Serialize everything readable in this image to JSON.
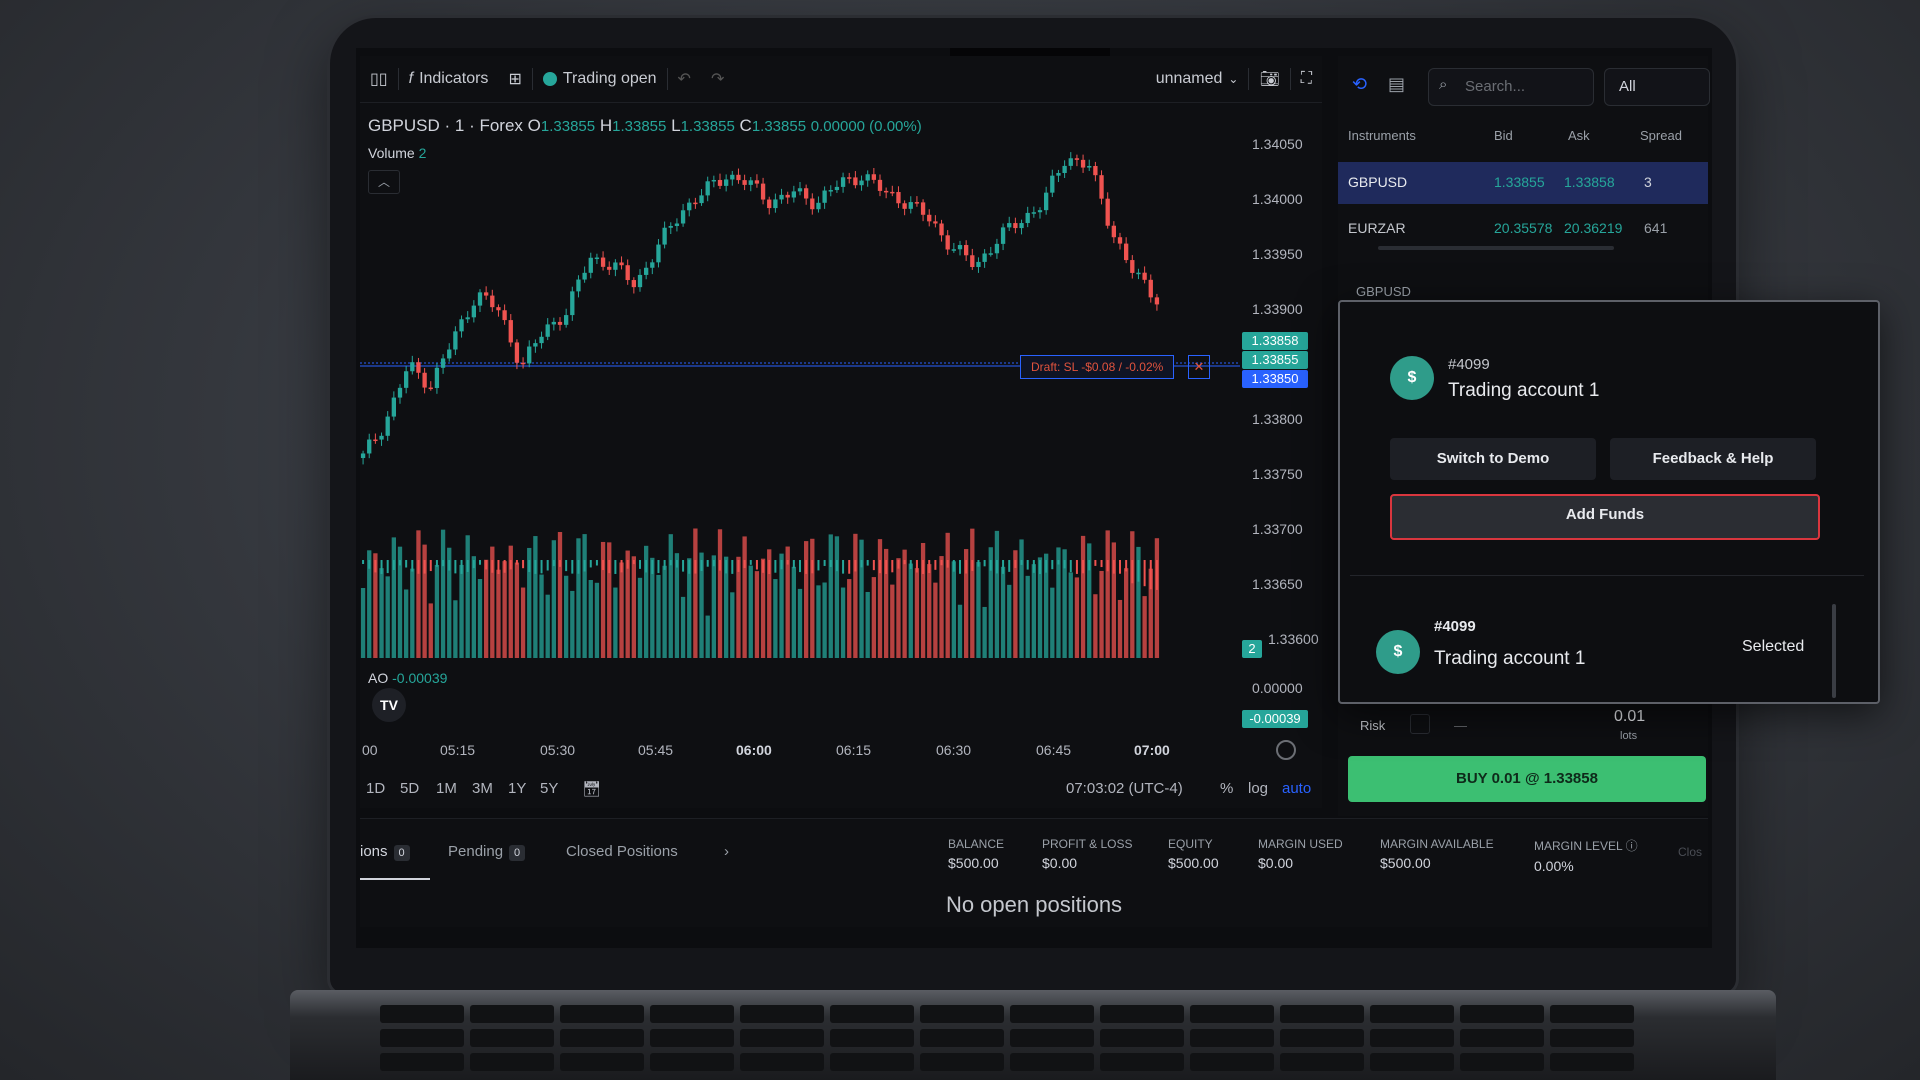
{
  "toolbar": {
    "indicators_label": "Indicators",
    "trading_status": "Trading open",
    "layout_name": "unnamed"
  },
  "chart": {
    "symbol": "GBPUSD · 1 · Forex",
    "open_label": "O",
    "open": "1.33855",
    "high_label": "H",
    "high": "1.33855",
    "low_label": "L",
    "low": "1.33855",
    "close_label": "C",
    "close": "1.33855",
    "change": "0.00000 (0.00%)",
    "volume_label": "Volume",
    "volume_value": "2",
    "ao_label": "AO",
    "ao_value": "-0.00039",
    "draft_label": "Draft: SL -$0.08 / -0.02%",
    "price_ticks": [
      "1.34050",
      "1.34000",
      "1.33950",
      "1.33900",
      "1.33800",
      "1.33750",
      "1.33700",
      "1.33650",
      "1.33600"
    ],
    "ao_tick": "0.00000",
    "badges": {
      "ask": "1.33858",
      "bid": "1.33855",
      "draft": "1.33850",
      "volume": "2",
      "ao": "-0.00039"
    },
    "time_ticks": [
      "00",
      "05:15",
      "05:30",
      "05:45",
      "06:00",
      "06:15",
      "06:30",
      "06:45",
      "07:00"
    ],
    "ranges": [
      "1D",
      "5D",
      "1M",
      "3M",
      "1Y",
      "5Y"
    ],
    "clock": "07:03:02 (UTC-4)",
    "pct": "%",
    "log": "log",
    "auto": "auto"
  },
  "chart_data": {
    "type": "candlestick",
    "symbol": "GBPUSD",
    "y_range": [
      1.336,
      1.3405
    ],
    "x_range": [
      "05:00",
      "07:03"
    ],
    "close_approx": [
      1.3368,
      1.3372,
      1.3378,
      1.3376,
      1.3381,
      1.3386,
      1.3384,
      1.3378,
      1.3382,
      1.3384,
      1.339,
      1.3389,
      1.3387,
      1.3391,
      1.3395,
      1.3397,
      1.3399,
      1.3398,
      1.3396,
      1.3397,
      1.3396,
      1.3398,
      1.3399,
      1.3397,
      1.3396,
      1.3394,
      1.3391,
      1.3389,
      1.3392,
      1.3394,
      1.3396,
      1.3401,
      1.34,
      1.3393,
      1.3388,
      1.33855
    ]
  },
  "bottom": {
    "tab_positions": "ions",
    "tab_positions_count": "0",
    "tab_pending": "Pending",
    "tab_pending_count": "0",
    "tab_closed": "Closed Positions",
    "metrics": [
      {
        "label": "BALANCE",
        "value": "$500.00"
      },
      {
        "label": "PROFIT & LOSS",
        "value": "$0.00"
      },
      {
        "label": "EQUITY",
        "value": "$500.00"
      },
      {
        "label": "MARGIN USED",
        "value": "$0.00"
      },
      {
        "label": "MARGIN AVAILABLE",
        "value": "$500.00"
      },
      {
        "label": "MARGIN LEVEL",
        "value": "0.00%"
      }
    ],
    "close_label": "Clos",
    "empty_text": "No open positions"
  },
  "right": {
    "search_placeholder": "Search...",
    "filter": "All",
    "headers": [
      "Instruments",
      "Bid",
      "Ask",
      "Spread"
    ],
    "rows": [
      {
        "symbol": "GBPUSD",
        "bid": "1.33855",
        "ask": "1.33858",
        "spread": "3"
      },
      {
        "symbol": "EURZAR",
        "bid": "20.35578",
        "ask": "20.36219",
        "spread": "641"
      }
    ],
    "trade_symbol": "GBPUSD",
    "risk_label": "Risk",
    "lots_value": "0.01",
    "lots_label": "lots",
    "buy_label": "BUY 0.01 @ 1.33858"
  },
  "popup": {
    "account_number": "#4099",
    "account_name": "Trading account 1",
    "switch_label": "Switch to Demo",
    "feedback_label": "Feedback & Help",
    "add_funds_label": "Add Funds",
    "list_account_number": "#4099",
    "list_account_name": "Trading account 1",
    "selected_label": "Selected",
    "avatar_glyph": "$"
  },
  "colors": {
    "up": "#26a69a",
    "down": "#ef5350",
    "accent": "#2962ff",
    "buy": "#3cbf72",
    "danger": "#d9363e"
  }
}
